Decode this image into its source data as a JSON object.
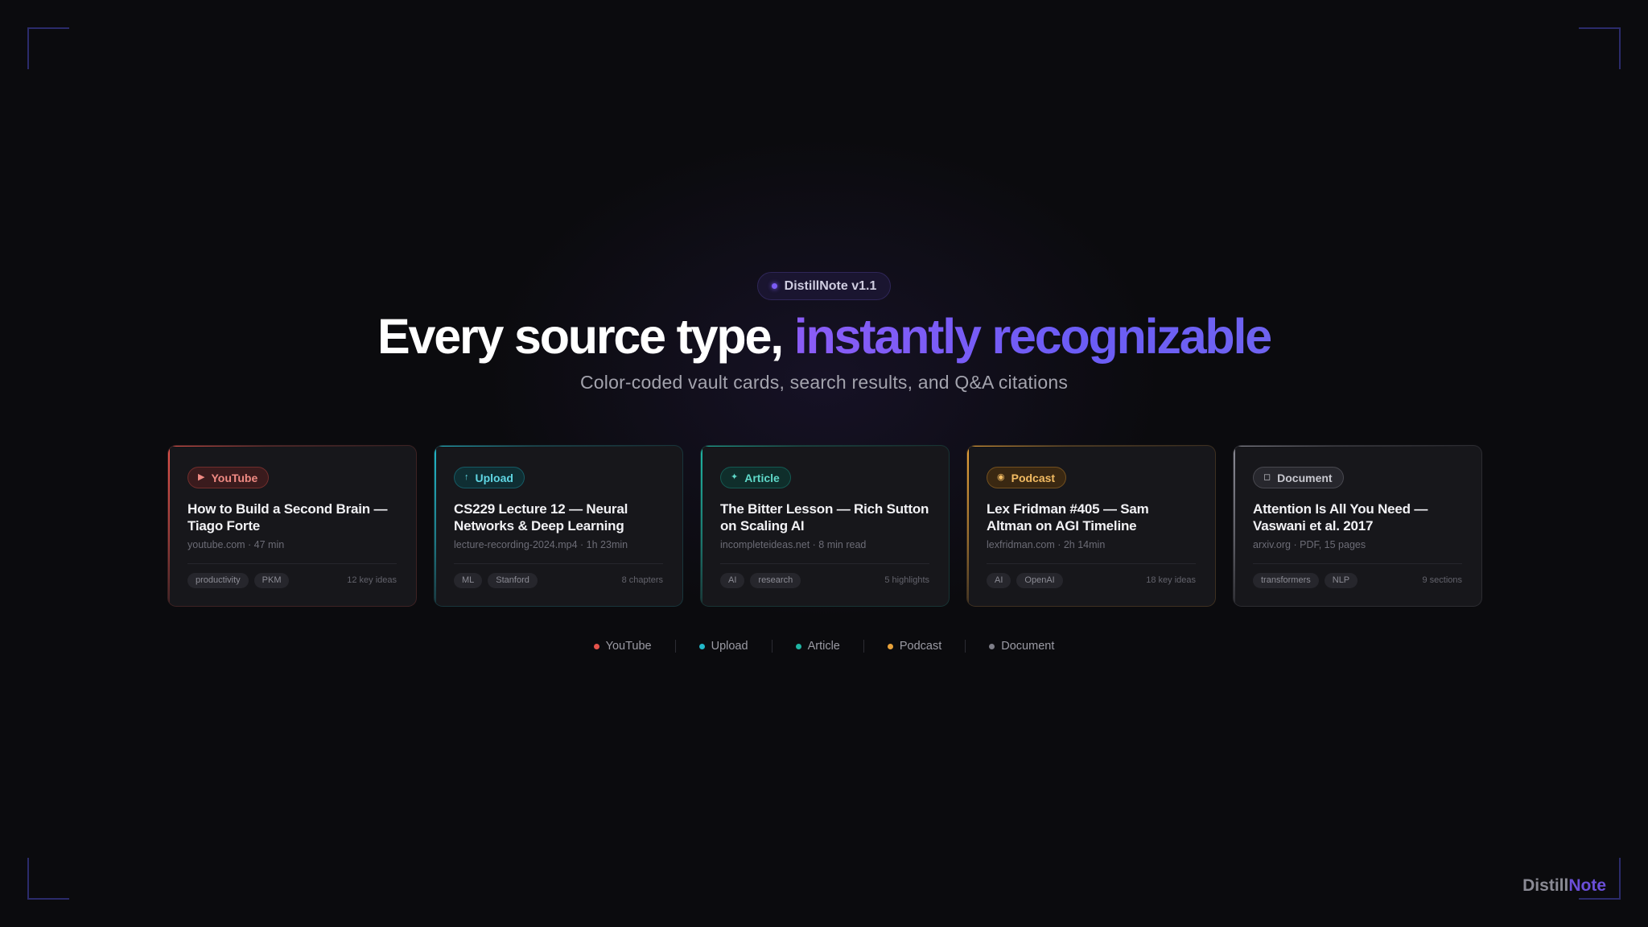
{
  "version_pill": {
    "label": "DistillNote v1.1",
    "color": "#7b5cf5"
  },
  "headline": {
    "plain": "Every source type,",
    "accent": "instantly recognizable"
  },
  "subhead": "Color-coded vault cards, search results, and Q&A citations",
  "cards": [
    {
      "type_label": "YouTube",
      "icon": "play-icon",
      "glyph": "▶",
      "color": "#e5534b",
      "badge_bg": "#3a1b1d",
      "badge_fg": "#f08a83",
      "title": "How to Build a Second Brain — Tiago Forte",
      "meta": "youtube.com · 47 min",
      "tags": [
        "productivity",
        "PKM"
      ],
      "count": "12 key ideas"
    },
    {
      "type_label": "Upload",
      "icon": "arrow-up-icon",
      "glyph": "↑",
      "color": "#22b8c9",
      "badge_bg": "#0f2e33",
      "badge_fg": "#5fd6e3",
      "title": "CS229 Lecture 12 — Neural Networks & Deep Learning",
      "meta": "lecture-recording-2024.mp4 · 1h 23min",
      "tags": [
        "ML",
        "Stanford"
      ],
      "count": "8 chapters"
    },
    {
      "type_label": "Article",
      "icon": "sparkle-icon",
      "glyph": "✦",
      "color": "#1fb5a3",
      "badge_bg": "#0f2e2b",
      "badge_fg": "#5fd9c9",
      "title": "The Bitter Lesson — Rich Sutton on Scaling AI",
      "meta": "incompleteideas.net · 8 min read",
      "tags": [
        "AI",
        "research"
      ],
      "count": "5 highlights"
    },
    {
      "type_label": "Podcast",
      "icon": "broadcast-icon",
      "glyph": "◉",
      "color": "#e8a23a",
      "badge_bg": "#3a2812",
      "badge_fg": "#f2bb62",
      "title": "Lex Fridman #405 — Sam Altman on AGI Timeline",
      "meta": "lexfridman.com · 2h 14min",
      "tags": [
        "AI",
        "OpenAI"
      ],
      "count": "18 key ideas"
    },
    {
      "type_label": "Document",
      "icon": "document-icon",
      "glyph": "◻",
      "color": "#8a8a94",
      "badge_bg": "#27272d",
      "badge_fg": "#c8c8cf",
      "title": "Attention Is All You Need — Vaswani et al. 2017",
      "meta": "arxiv.org · PDF, 15 pages",
      "tags": [
        "transformers",
        "NLP"
      ],
      "count": "9 sections"
    }
  ],
  "legend": [
    {
      "label": "YouTube",
      "color": "#e5534b"
    },
    {
      "label": "Upload",
      "color": "#22b8c9"
    },
    {
      "label": "Article",
      "color": "#1fb5a3"
    },
    {
      "label": "Podcast",
      "color": "#e8a23a"
    },
    {
      "label": "Document",
      "color": "#7e7e88"
    }
  ],
  "brand": {
    "plain": "Distill",
    "accent": "Note"
  }
}
